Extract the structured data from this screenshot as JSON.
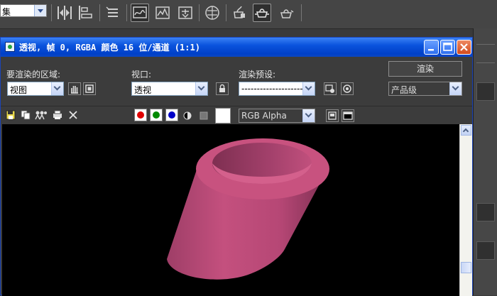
{
  "toolbar": {
    "named_selection_value": "集",
    "icons": [
      "mirror-icon",
      "align-icon",
      "layer-manager-icon",
      "curve-editor-icon",
      "schematic-view-icon",
      "material-editor-icon",
      "render-setup-icon",
      "rendered-frame-window-icon",
      "render-production-icon"
    ]
  },
  "window": {
    "title": "透视, 帧 0, RGBA 颜色 16 位/通道 (1:1)"
  },
  "controls": {
    "area_label": "要渲染的区域:",
    "area_value": "视图",
    "viewport_label": "视口:",
    "viewport_value": "透视",
    "preset_label": "渲染预设:",
    "preset_value": "--------------------",
    "render_button": "渲染",
    "render_mode_value": "产品级"
  },
  "frame_toolbar": {
    "channel_value": "RGB Alpha",
    "red_color": "#e00000",
    "green_color": "#008a00",
    "blue_color": "#0000c8"
  },
  "scene": {
    "object_color": "#c4507e",
    "background": "#000000"
  }
}
